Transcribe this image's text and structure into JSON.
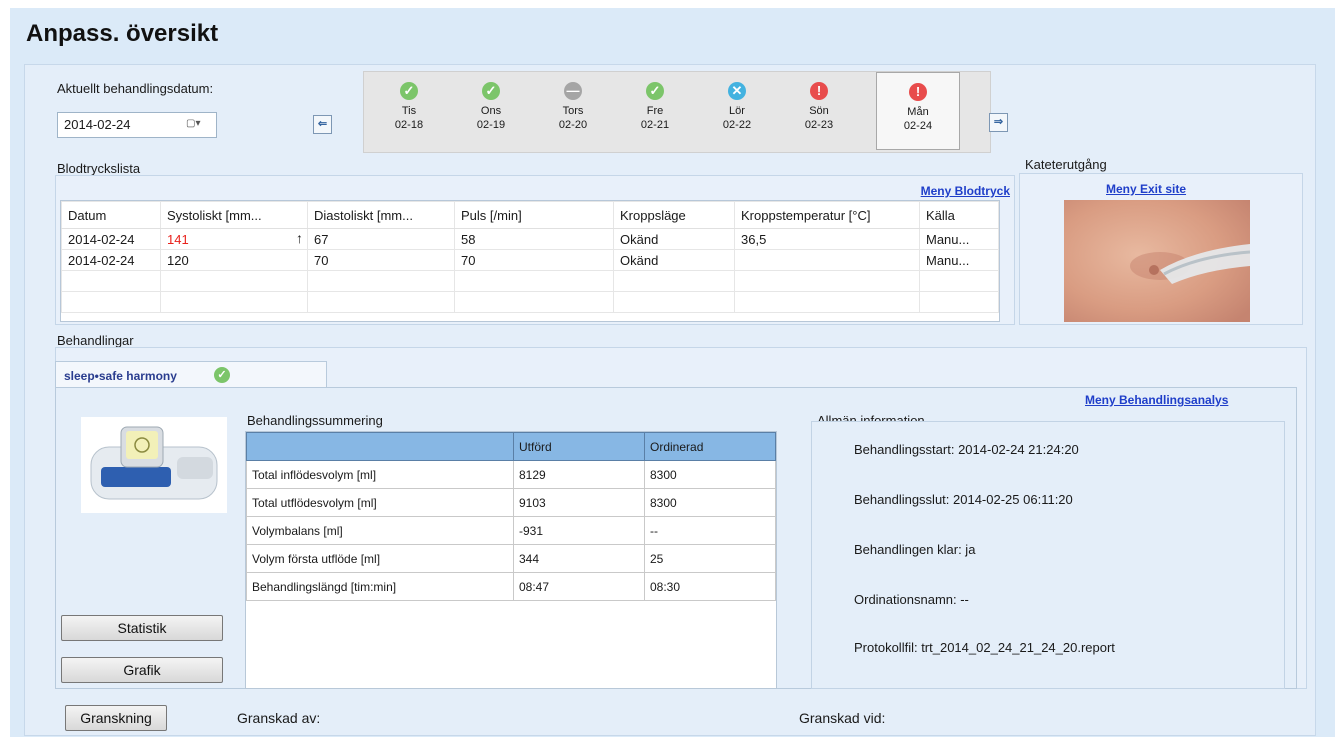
{
  "title": "Anpass. översikt",
  "date_label": "Aktuellt behandlingsdatum:",
  "date_value": "2014-02-24",
  "days": [
    {
      "day": "Tis",
      "date": "02-18",
      "status": "ok",
      "icon": "check-icon"
    },
    {
      "day": "Ons",
      "date": "02-19",
      "status": "ok",
      "icon": "check-icon"
    },
    {
      "day": "Tors",
      "date": "02-20",
      "status": "stop",
      "icon": "minus-icon"
    },
    {
      "day": "Fre",
      "date": "02-21",
      "status": "ok",
      "icon": "check-icon"
    },
    {
      "day": "Lör",
      "date": "02-22",
      "status": "x",
      "icon": "x-icon"
    },
    {
      "day": "Sön",
      "date": "02-23",
      "status": "warn",
      "icon": "exclamation-icon"
    },
    {
      "day": "Mån",
      "date": "02-24",
      "status": "warn",
      "icon": "exclamation-icon"
    }
  ],
  "bp": {
    "label": "Blodtryckslista",
    "menu": "Meny Blodtryck",
    "columns": [
      "Datum",
      "Systoliskt [mm...",
      "Diastoliskt [mm...",
      "Puls [/min]",
      "Kroppsläge",
      "Kroppstemperatur [°C]",
      "Källa"
    ],
    "rows": [
      [
        "2014-02-24",
        "141",
        "67",
        "58",
        "Okänd",
        "36,5",
        "Manu..."
      ],
      [
        "2014-02-24",
        "120",
        "70",
        "70",
        "Okänd",
        "",
        "Manu..."
      ]
    ]
  },
  "catheter": {
    "label": "Kateterutgång",
    "menu": "Meny Exit site"
  },
  "treatments": {
    "label": "Behandlingar",
    "tab": "sleep•safe harmony",
    "menu": "Meny Behandlingsanalys",
    "summary_label": "Behandlingssummering",
    "summary_cols": [
      "",
      "Utförd",
      "Ordinerad"
    ],
    "summary_rows": [
      [
        "Total inflödesvolym [ml]",
        "8129",
        "8300"
      ],
      [
        "Total utflödesvolym [ml]",
        "9103",
        "8300"
      ],
      [
        "Volymbalans [ml]",
        "-931",
        "--"
      ],
      [
        "Volym första utflöde [ml]",
        "344",
        "25"
      ],
      [
        "Behandlingslängd [tim:min]",
        "08:47",
        "08:30"
      ]
    ],
    "info_label": "Allmän information",
    "info": [
      "Behandlingsstart: 2014-02-24 21:24:20",
      "Behandlingsslut: 2014-02-25 06:11:20",
      "Behandlingen klar: ja",
      "Ordinationsnamn: --",
      "Protokollfil: trt_2014_02_24_21_24_20.report"
    ],
    "btn_statistik": "Statistik",
    "btn_grafik": "Grafik"
  },
  "footer": {
    "review_btn": "Granskning",
    "reviewed_by": "Granskad av:",
    "reviewed_at": "Granskad vid:"
  },
  "colors": {
    "highlight_red": "#e8221c",
    "link": "#1f3ec9"
  }
}
